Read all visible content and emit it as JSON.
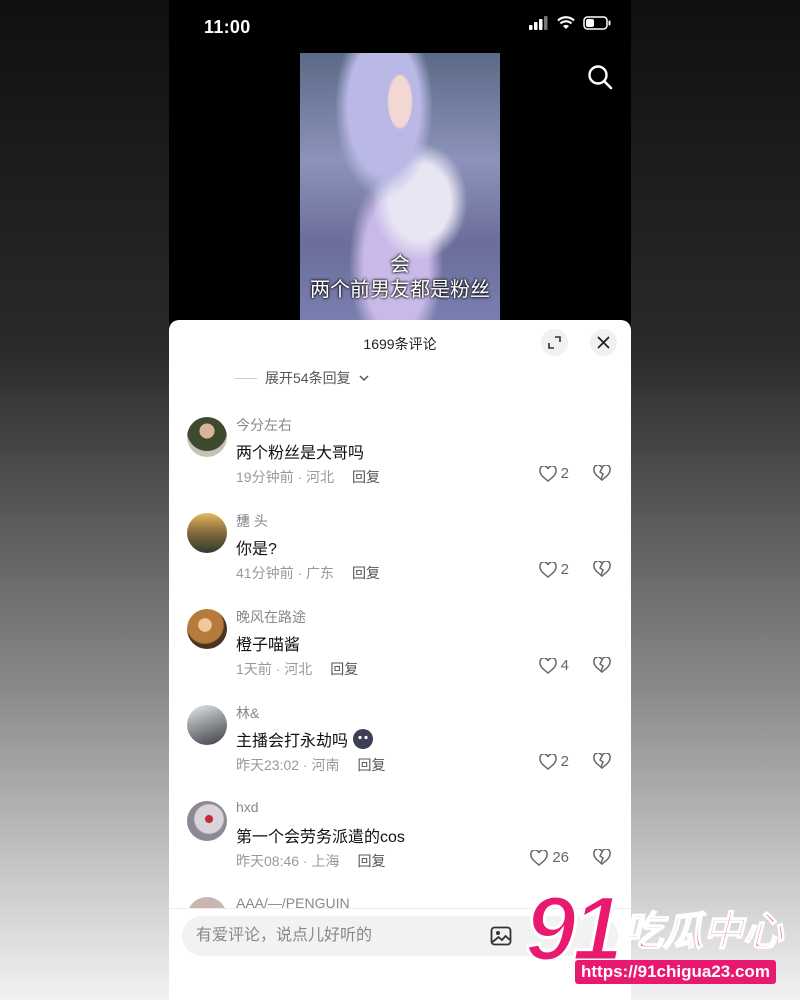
{
  "status": {
    "time": "11:00"
  },
  "video": {
    "caption_line1": "会",
    "caption_line2": "两个前男友都是粉丝"
  },
  "sheet": {
    "title": "1699条评论",
    "more_replies": "展开54条回复"
  },
  "comments": [
    {
      "user": "今分左右",
      "text": "两个粉丝是大哥吗",
      "meta": "19分钟前 · 河北",
      "reply": "回复",
      "likes": "2",
      "avatar_color": "#5b4a3a"
    },
    {
      "user": "㘒 头",
      "text": "你是?",
      "meta": "41分钟前 · 广东",
      "reply": "回复",
      "likes": "2",
      "avatar_color": "#c9a46b"
    },
    {
      "user": "晚风在路途",
      "text": "橙子喵酱",
      "meta": "1天前 · 河北",
      "reply": "回复",
      "likes": "4",
      "avatar_color": "#a0763a"
    },
    {
      "user": "林&",
      "text": "主播会打永劫吗",
      "meta": "昨天23:02 · 河南",
      "reply": "回复",
      "likes": "2",
      "avatar_color": "#6c6f73"
    },
    {
      "user": "hxd",
      "text": "第一个会劳务派遣的cos",
      "meta": "昨天08:46 · 上海",
      "reply": "回复",
      "likes": "26",
      "avatar_color": "#b8b0c2"
    }
  ],
  "partial_comment": {
    "user": "AAA/—/PENGUIN"
  },
  "input": {
    "placeholder": "有爱评论，说点儿好听的"
  },
  "watermark": {
    "number": "91",
    "name": "吃瓜中心",
    "url": "https://91chigua23.com"
  },
  "colors": {
    "watermark": "#e8196e",
    "sheet_bg": "#ffffff"
  }
}
